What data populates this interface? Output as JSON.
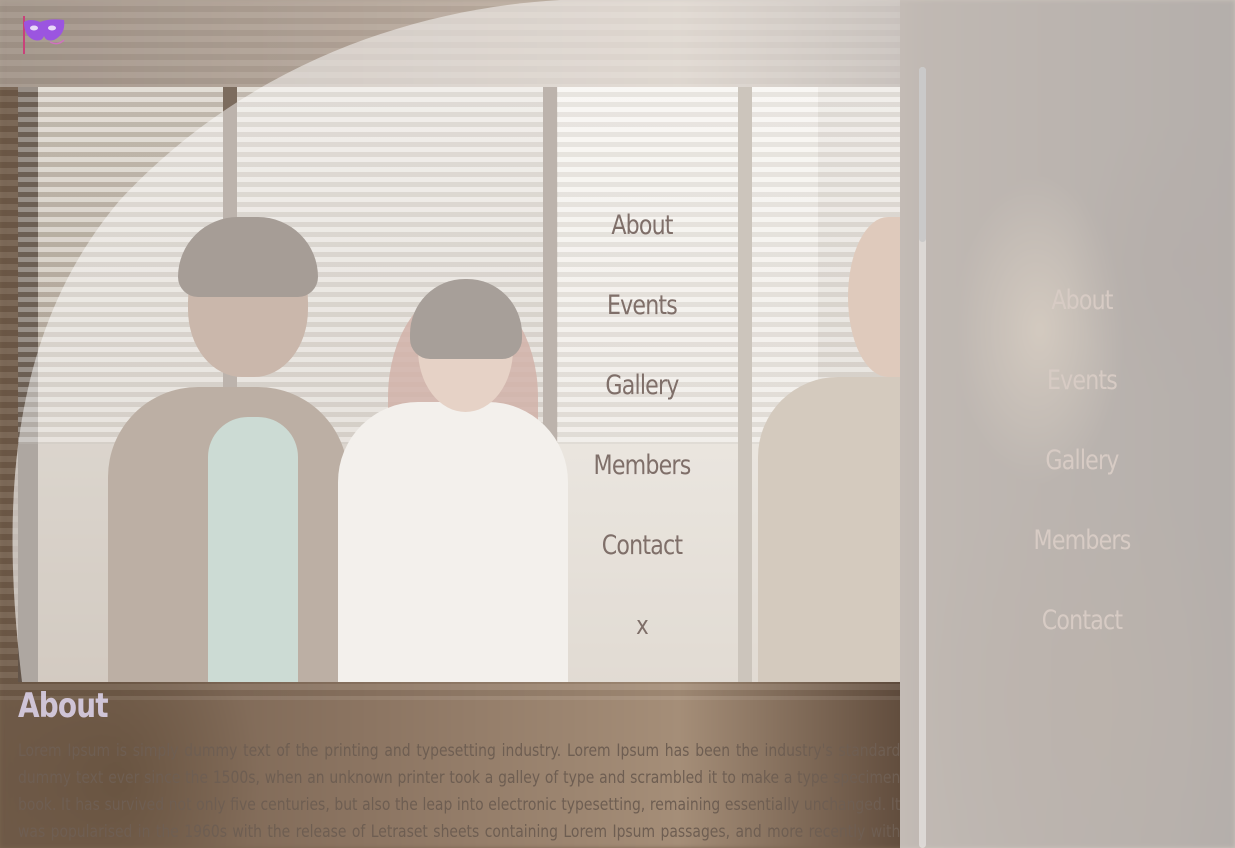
{
  "logo": {
    "icon": "masquerade-mask-icon",
    "color": "#9b55e0"
  },
  "main_menu": {
    "items": [
      {
        "label": "About"
      },
      {
        "label": "Events"
      },
      {
        "label": "Gallery"
      },
      {
        "label": "Members"
      },
      {
        "label": "Contact"
      }
    ],
    "close_label": "x"
  },
  "side_menu": {
    "items": [
      {
        "label": "About"
      },
      {
        "label": "Events"
      },
      {
        "label": "Gallery"
      },
      {
        "label": "Members"
      },
      {
        "label": "Contact"
      }
    ]
  },
  "about": {
    "title": "About",
    "body": "Lorem Ipsum is simply dummy text of the printing and typesetting industry. Lorem Ipsum has been the industry's standard dummy text ever since the 1500s, when an unknown printer took a galley of type and scrambled it to make a type specimen book. It has survived not only five centuries, but also the leap into electronic typesetting, remaining essentially unchanged. It was popularised in the 1960s with the release of Letraset sheets containing Lorem Ipsum passages, and more recently with desktop publishing software like Aldus"
  }
}
